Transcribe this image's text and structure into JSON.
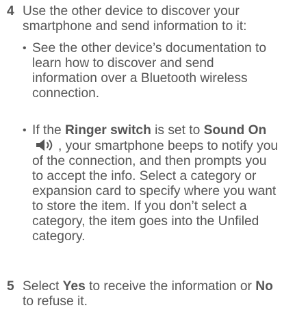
{
  "steps": [
    {
      "number": "4",
      "text": "Use the other device to discover your smartphone and send information to it:"
    },
    {
      "number": "5",
      "parts": [
        "Select ",
        "Yes",
        " to receive the information or ",
        "No",
        " to refuse it."
      ]
    }
  ],
  "bullets": [
    {
      "symbol": "•",
      "text": "See the other device’s documentation to learn how to discover and send information over a Bluetooth wireless connection."
    },
    {
      "symbol": "•",
      "parts": [
        "If the ",
        "Ringer switch",
        " is set to ",
        "Sound On",
        ", your smartphone beeps to notify you of the connection, and then prompts you to accept the info. Select a category or expansion card to specify where you want to store the item. If you don’t select a category, the item goes into the Unfiled category."
      ],
      "icon": "speaker-sound-on-icon"
    }
  ]
}
